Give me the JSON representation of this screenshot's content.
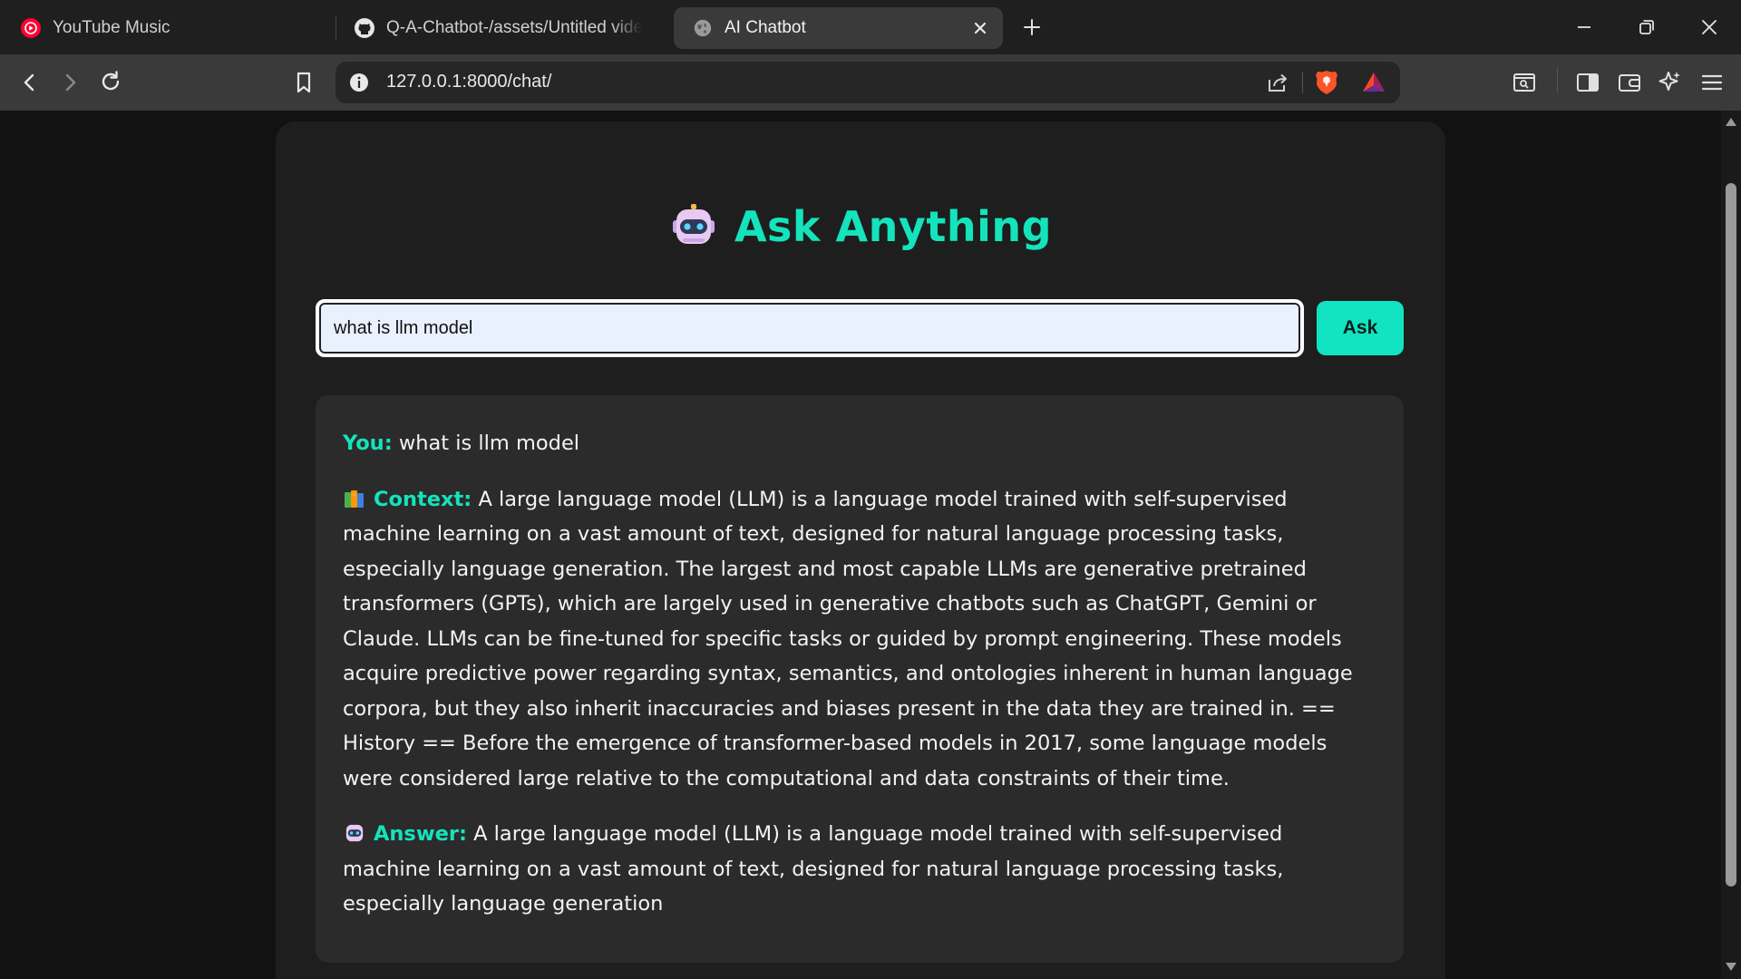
{
  "browser": {
    "tabs": [
      {
        "title": "YouTube Music",
        "icon": "youtube-music-icon",
        "active": false
      },
      {
        "title": "Q-A-Chatbot-/assets/Untitled video",
        "icon": "github-icon",
        "active": false
      },
      {
        "title": "AI Chatbot",
        "icon": "globe-icon",
        "active": true
      }
    ],
    "url": "127.0.0.1:8000/chat/"
  },
  "colors": {
    "accent": "#14e3bb",
    "button": "#12e3c0",
    "page_bg": "#121212",
    "card_bg": "#1e1e1e",
    "response_bg": "#2b2b2b",
    "input_bg": "#e9f0fe"
  },
  "page": {
    "title": "Ask Anything",
    "title_icon": "robot-icon",
    "query_value": "what is llm model",
    "ask_label": "Ask",
    "chat": {
      "you_label": "You:",
      "you_text": "what is llm model",
      "context_icon": "books-icon",
      "context_label": "Context:",
      "context_text": "A large language model (LLM) is a language model trained with self-supervised machine learning on a vast amount of text, designed for natural language processing tasks, especially language generation. The largest and most capable LLMs are generative pretrained transformers (GPTs), which are largely used in generative chatbots such as ChatGPT, Gemini or Claude. LLMs can be fine-tuned for specific tasks or guided by prompt engineering. These models acquire predictive power regarding syntax, semantics, and ontologies inherent in human language corpora, but they also inherit inaccuracies and biases present in the data they are trained in. == History == Before the emergence of transformer-based models in 2017, some language models were considered large relative to the computational and data constraints of their time.",
      "answer_icon": "robot-icon",
      "answer_label": "Answer:",
      "answer_text": "A large language model (LLM) is a language model trained with self-supervised machine learning on a vast amount of text, designed for natural language processing tasks, especially language generation"
    }
  }
}
